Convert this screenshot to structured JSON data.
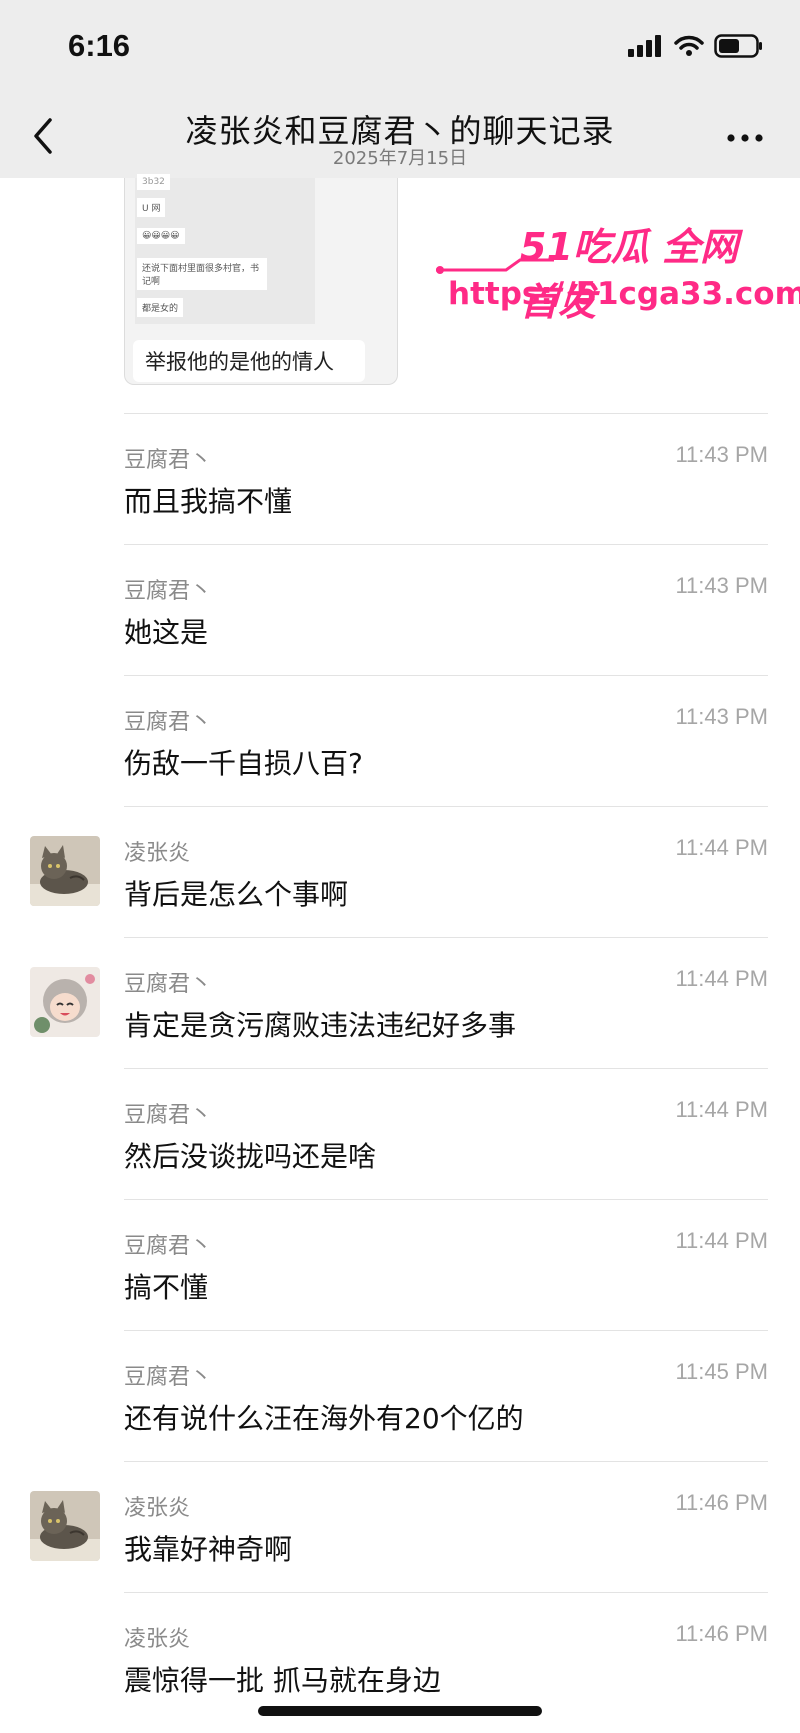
{
  "status": {
    "time": "6:16"
  },
  "header": {
    "title": "凌张炎和豆腐君丶的聊天记录",
    "subtitle": "2025年7月15日"
  },
  "quoted": {
    "mini_lines": [
      "3b32",
      "U 网",
      "😀😀😀😀",
      "还说下面村里面很多村官，书记啊",
      "都是女的"
    ],
    "caption": "举报他的是他的情人"
  },
  "watermark": {
    "brand": "51吃瓜 全网首发",
    "url": "https://51cga33.com"
  },
  "messages": [
    {
      "sender": "豆腐君丶",
      "time": "11:43 PM",
      "text": "而且我搞不懂"
    },
    {
      "sender": "豆腐君丶",
      "time": "11:43 PM",
      "text": "她这是"
    },
    {
      "sender": "豆腐君丶",
      "time": "11:43 PM",
      "text": "伤敌一千自损八百?"
    },
    {
      "sender": "凌张炎",
      "time": "11:44 PM",
      "text": "背后是怎么个事啊"
    },
    {
      "sender": "豆腐君丶",
      "time": "11:44 PM",
      "text": "肯定是贪污腐败违法违纪好多事"
    },
    {
      "sender": "豆腐君丶",
      "time": "11:44 PM",
      "text": "然后没谈拢吗还是啥"
    },
    {
      "sender": "豆腐君丶",
      "time": "11:44 PM",
      "text": "搞不懂"
    },
    {
      "sender": "豆腐君丶",
      "time": "11:45 PM",
      "text": "还有说什么汪在海外有20个亿的"
    },
    {
      "sender": "凌张炎",
      "time": "11:46 PM",
      "text": "我靠好神奇啊"
    },
    {
      "sender": "凌张炎",
      "time": "11:46 PM",
      "text": "震惊得一批 抓马就在身边"
    }
  ],
  "colors": {
    "bar_bg": "#ededed",
    "watermark": "#ff2a86",
    "divider": "#e3e3e3"
  }
}
